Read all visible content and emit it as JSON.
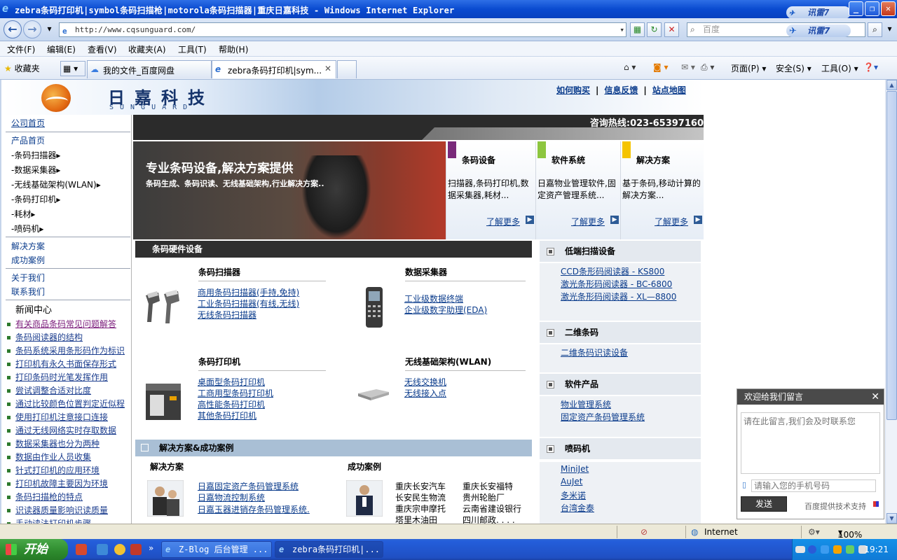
{
  "window": {
    "title": "zebra条码打印机|symbol条码扫描枪|motorola条码扫描器|重庆日嘉科技 - Windows Internet Explorer",
    "xunlei_label": "讯雷7"
  },
  "address_bar": {
    "url": "http://www.cqsunguard.com/",
    "search_placeholder": "百度"
  },
  "menu": [
    "文件(F)",
    "编辑(E)",
    "查看(V)",
    "收藏夹(A)",
    "工具(T)",
    "帮助(H)"
  ],
  "favorites_label": "收藏夹",
  "tabs": [
    {
      "label": "我的文件_百度网盘"
    },
    {
      "label": "zebra条码打印机|sym..."
    }
  ],
  "commands": {
    "page": "页面(P)",
    "safety": "安全(S)",
    "tools": "工具(O)"
  },
  "site": {
    "logo_cn": "日嘉科技",
    "logo_en": "SUNGUARD",
    "top_links": [
      "如何购买",
      "信息反馈",
      "站点地图"
    ],
    "hotline": "咨询热线:023-65397160"
  },
  "left_nav": {
    "items": [
      "公司首页",
      "产品首页",
      "-条码扫描器▸",
      "-数据采集器▸",
      "-无线基础架构(WLAN)▸",
      "-条码打印机▸",
      "-耗材▸",
      "-喷码机▸",
      "解决方案",
      "成功案例",
      "关于我们",
      "联系我们"
    ],
    "news_title": "新闻中心",
    "news": [
      "有关商品条码常见问题解答",
      "条码阅读器的结构",
      "条码系统采用条形码作为标识",
      "打印机有永久书面保存形式",
      "打印条码时光笔发挥作用",
      "尝试调整合适对比度",
      "通过比较颜色位置判定近似程",
      "使用打印机注意接口连接",
      "通过无线网络实时存取数据",
      "数据采集器也分为两种",
      "数据由作业人员收集",
      "针式打印机的应用环境",
      "打印机故障主要因为环境",
      "条码扫描枪的特点",
      "识读器质量影响识读质量",
      "手动读法打印机步骤"
    ]
  },
  "banner": {
    "headline": "专业条码设备,解决方案提供",
    "subline": "条码生成、条码识读、无线基础架构,行业解决方案.."
  },
  "features": [
    {
      "title": "条码设备",
      "desc": "扫描器,条码打印机,数据采集器,耗材...",
      "more": "了解更多",
      "color": "#7a2a7a"
    },
    {
      "title": "软件系统",
      "desc": "日嘉物业管理软件,固定资产管理系统...",
      "more": "了解更多",
      "color": "#8dc63f"
    },
    {
      "title": "解决方案",
      "desc": "基于条码,移动计算的解决方案...",
      "more": "了解更多",
      "color": "#f5c400"
    }
  ],
  "hardware": {
    "heading": "条码硬件设备",
    "scanners": {
      "title": "条码扫描器",
      "links": [
        "商用条码扫描器(手持,免持)",
        "工业条码扫描器(有线,无线)",
        "无线条码扫描器"
      ]
    },
    "collectors": {
      "title": "数据采集器",
      "links": [
        "工业级数据终端",
        "企业级数字助理(EDA)"
      ]
    },
    "printers": {
      "title": "条码打印机",
      "links": [
        "桌面型条码打印机",
        "工商用型条码打印机",
        "高性能条码打印机",
        "其他条码打印机"
      ]
    },
    "wlan": {
      "title": "无线基础架构(WLAN)",
      "links": [
        "无线交换机",
        "无线接入点"
      ]
    }
  },
  "solutions": {
    "heading": "解决方案&成功案例",
    "solutions_title": "解决方案",
    "solution_links": [
      "日嘉固定资产条码管理系统",
      "日嘉物流控制系统",
      "日嘉玉器进销存条码管理系统."
    ],
    "cases_title": "成功案例",
    "cases": [
      "重庆长安汽车",
      "重庆长安福特",
      "长安民生物流",
      "贵州轮胎厂",
      "重庆宗申摩托",
      "云南省建设银行",
      "塔里木油田",
      "四川邮政. . . ."
    ]
  },
  "right_col": {
    "sections": [
      {
        "title": "低端扫描设备",
        "links": [
          "CCD条形码阅读器 - KS800",
          "激光条形码阅读器 - BC-6800",
          "激光条形码阅读器 - XL—8800"
        ]
      },
      {
        "title": "二维条码",
        "links": [
          "二维条码识读设备"
        ]
      },
      {
        "title": "软件产品",
        "links": [
          "物业管理系统",
          "固定资产条码管理系统"
        ]
      },
      {
        "title": "喷码机",
        "links": [
          "MiniJet",
          "AuJet",
          "多米诺",
          "台湾金泰"
        ]
      }
    ]
  },
  "chat": {
    "title": "欢迎给我们留言",
    "message_placeholder": "请在此留言,我们会及时联系您",
    "phone_placeholder": "请输入您的手机号码",
    "send_label": "发送",
    "powered": "百度提供技术支持"
  },
  "status": {
    "zone": "Internet",
    "zoom": "100%"
  },
  "taskbar": {
    "start_label": "开始",
    "tasks": [
      "Z-Blog 后台管理 ...",
      "zebra条码打印机|..."
    ],
    "clock": "19:21"
  }
}
